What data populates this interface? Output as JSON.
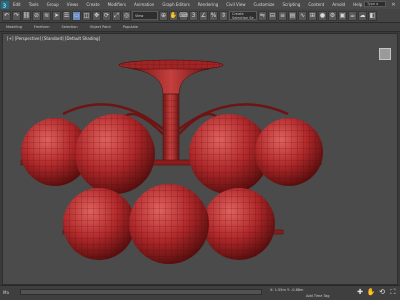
{
  "menubar": {
    "items": [
      "Edit",
      "Tools",
      "Group",
      "Views",
      "Create",
      "Modifiers",
      "Animation",
      "Graph Editors",
      "Rendering",
      "Civil View",
      "Customize",
      "Scripting",
      "Content",
      "Arnold",
      "Help"
    ]
  },
  "toolbar": {
    "selection_set": "Create Selection Se",
    "view_dropdown": "View",
    "search_placeholder": "Type a"
  },
  "ribbon": {
    "tabs": [
      "Modeling",
      "Freeform",
      "Selection",
      "Object Paint",
      "Populate"
    ]
  },
  "viewport": {
    "label": "[+] [Perspective] [Standard] [Default Shading]",
    "colors": {
      "mesh": "#b0282a",
      "mesh_light": "#d04a48",
      "mesh_dark": "#6e1414",
      "wire": "#4a0c0c",
      "bg": "#4b4b4b"
    }
  },
  "status": {
    "left_text": "Ma",
    "coord_text": "X: 1.55m  Y: -0.88m",
    "add_time_tag": "Add Time Tag"
  }
}
